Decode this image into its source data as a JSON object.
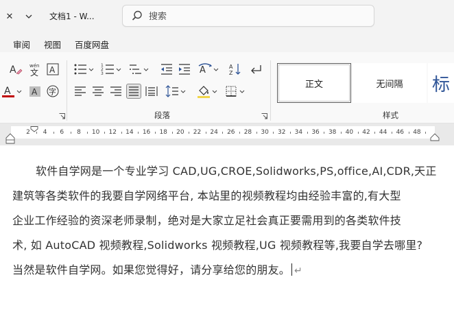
{
  "window": {
    "title": "文档1 - W...",
    "close_glyph": "✕",
    "quick_access_glyph": "⌄"
  },
  "search": {
    "placeholder": "搜索"
  },
  "menu": {
    "items": [
      "审阅",
      "视图",
      "百度网盘"
    ]
  },
  "ribbon": {
    "groups": {
      "font_partial": {
        "phonetic_label": "wén"
      },
      "paragraph": {
        "label": "段落"
      },
      "styles": {
        "label": "样式",
        "items": [
          "正文",
          "无间隔",
          "标"
        ]
      }
    },
    "colors": {
      "font_color_bar": "#c00000",
      "shading_bar": "#f2d64b",
      "heading_blue": "#2f5597"
    }
  },
  "ruler": {
    "numbers": [
      "2",
      "4",
      "6",
      "8",
      "10",
      "12",
      "14",
      "16",
      "18",
      "20",
      "22",
      "24",
      "26",
      "28",
      "30",
      "32",
      "34",
      "36",
      "38",
      "40",
      "42",
      "44",
      "46",
      "48"
    ]
  },
  "document": {
    "lines": [
      "软件自学网是一个专业学习 CAD,UG,CROE,Solidworks,PS,office,AI,CDR,天正",
      "建筑等各类软件的我要自学网络平台, 本站里的视频教程均由经验丰富的,有大型",
      "企业工作经验的资深老师录制，绝对是大家立足社会真正要需用到的各类软件技",
      "术, 如 AutoCAD 视频教程,Solidworks 视频教程,UG 视频教程等,我要自学去哪里?",
      "当然是软件自学网。如果您觉得好，请分享给您的朋友。"
    ],
    "paragraph_mark": "↵"
  }
}
